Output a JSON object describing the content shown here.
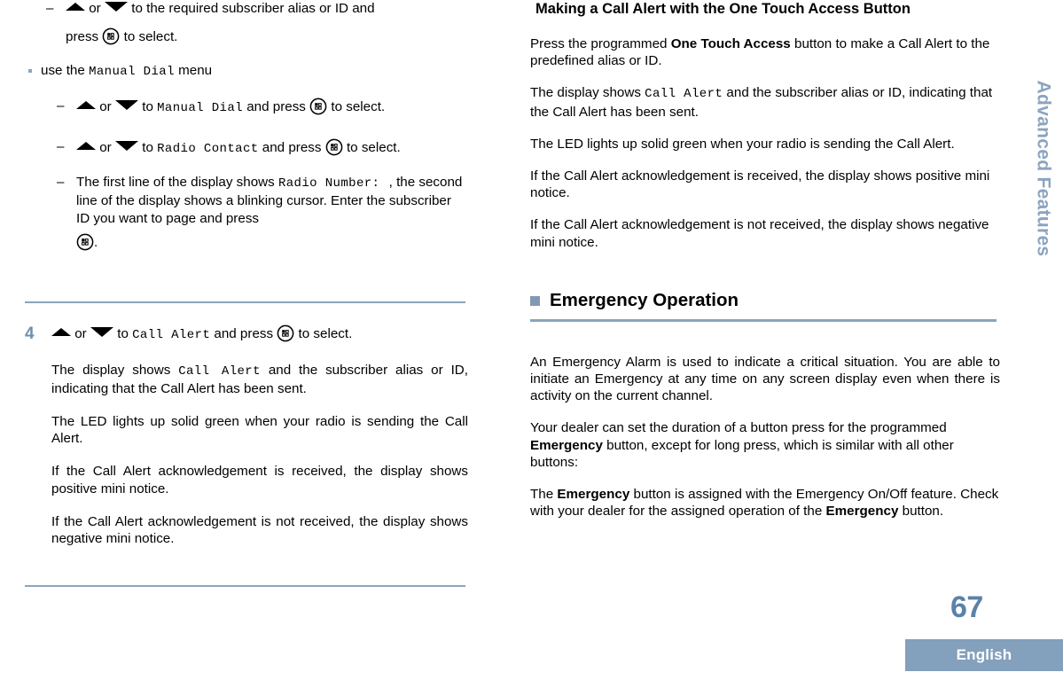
{
  "document": {
    "page_number": "67",
    "language_label": "English",
    "side_tab_label": "Advanced Features",
    "colors": {
      "accent_blue": "#8ba4bf",
      "page_number_blue": "#5b82a8",
      "language_bar_blue": "#83a0bd",
      "step_number_blue": "#6f8fae",
      "heading_square_blue": "#8398b4"
    }
  },
  "left_column": {
    "sub_steps": [
      {
        "dash": "–",
        "pre": "",
        "icon_up": "up-triangle-icon",
        "or": "or",
        "icon_down": "down-triangle-icon",
        "mid": "to the required subscriber alias or ID and",
        "line2_pre": "press",
        "icon_menu": "menu-icon",
        "line2_post": "to select."
      }
    ],
    "bullet": {
      "marker": "bullet-square",
      "pre": "use the",
      "mono": "Manual Dial",
      "post": "menu"
    },
    "manual_dial_steps": [
      {
        "dash": "–",
        "or": "or",
        "to": "to",
        "mono": "Manual Dial",
        "and_press": "and press",
        "to_select": "to select."
      },
      {
        "dash": "–",
        "or": "or",
        "to": "to",
        "mono": "Radio Contact",
        "and_press": "and press",
        "to_select": "to select."
      }
    ],
    "radio_number_step": {
      "dash": "–",
      "text_a": "The first line of the display shows",
      "mono_a": "Radio Number:",
      "comma": ",",
      "text_b": "the second line of the display shows a blinking cursor. Enter the subscriber ID you want to page and press",
      "period": "."
    },
    "step4": {
      "number": "4",
      "or": "or",
      "to": "to",
      "mono": "Call Alert",
      "and_press": "and press",
      "to_select": "to select."
    },
    "paragraphs": [
      {
        "pre": "The display shows",
        "mono": "Call Alert",
        "post": "and the subscriber alias or ID, indicating that the Call Alert has been sent."
      },
      {
        "text": "The LED lights up solid green when your radio is sending the Call Alert."
      },
      {
        "text": "If the Call Alert acknowledgement is received, the display shows positive mini notice."
      },
      {
        "text": "If the Call Alert acknowledgement is not received, the display shows negative mini notice."
      }
    ]
  },
  "right_column": {
    "heading": "Making a Call Alert with the One Touch Access Button",
    "paragraphs": [
      {
        "pre": "Press the programmed",
        "bold": "One Touch Access",
        "post": "button to make a Call Alert to the predefined alias or ID."
      },
      {
        "pre": "The display shows",
        "mono": "Call Alert",
        "post": "and the subscriber alias or ID, indicating that the Call Alert has been sent."
      },
      {
        "text": "The LED lights up solid green when your radio is sending the Call Alert."
      },
      {
        "text": "If the Call Alert acknowledgement is received, the display shows positive mini notice."
      },
      {
        "text": "If the Call Alert acknowledgement is not received, the display shows negative mini notice."
      }
    ],
    "section_heading": "Emergency Operation",
    "emergency_paragraphs": [
      {
        "text": "An Emergency Alarm is used to indicate a critical situation. You are able to initiate an Emergency at any time on any screen display even when there is activity on the current channel."
      },
      {
        "pre": "Your dealer can set the duration of a button press for the programmed",
        "bold": "Emergency",
        "post": "button, except for long press, which is similar with all other buttons:"
      },
      {
        "pre": "The",
        "bold": "Emergency",
        "mid": "button is assigned with the Emergency On/Off feature. Check with your dealer for the assigned operation of the",
        "bold2": "Emergency",
        "post": "button."
      }
    ]
  }
}
